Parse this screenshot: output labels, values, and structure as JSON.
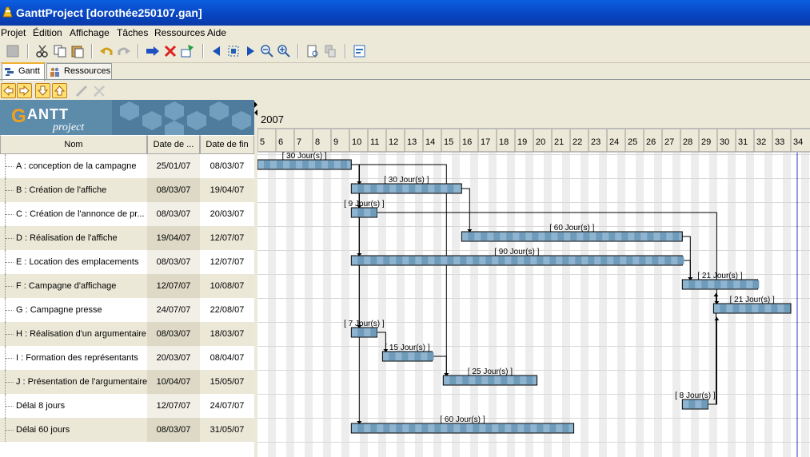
{
  "window": {
    "title": "GanttProject [dorothée250107.gan]"
  },
  "menu": [
    "Projet",
    "Édition",
    "Affichage",
    "Tâches",
    "Ressources",
    "Aide"
  ],
  "toolbar": {
    "icons": [
      "stop-icon",
      "cut-icon",
      "copy-icon",
      "paste-icon",
      "undo-icon",
      "redo-icon",
      "indent-icon",
      "delete-icon",
      "new-task-icon",
      "scroll-left-icon",
      "fit-icon",
      "scroll-right-icon",
      "zoom-out-icon",
      "zoom-in-icon",
      "preview-icon",
      "print-icon",
      "export-icon"
    ]
  },
  "tabs": [
    {
      "label": "Gantt"
    },
    {
      "label": "Ressources"
    }
  ],
  "table": {
    "columns": [
      "Nom",
      "Date de ...",
      "Date de fin"
    ],
    "rows": [
      {
        "name": "A : conception de la campagne",
        "start": "25/01/07",
        "end": "08/03/07"
      },
      {
        "name": "B : Création de l'affiche",
        "start": "08/03/07",
        "end": "19/04/07"
      },
      {
        "name": "C : Création de l'annonce de pr...",
        "start": "08/03/07",
        "end": "20/03/07"
      },
      {
        "name": "D : Réalisation de l'affiche",
        "start": "19/04/07",
        "end": "12/07/07"
      },
      {
        "name": "E : Location des emplacements",
        "start": "08/03/07",
        "end": "12/07/07"
      },
      {
        "name": "F : Campagne d'affichage",
        "start": "12/07/07",
        "end": "10/08/07"
      },
      {
        "name": "G : Campagne presse",
        "start": "24/07/07",
        "end": "22/08/07"
      },
      {
        "name": "H : Réalisation d'un argumentaire",
        "start": "08/03/07",
        "end": "18/03/07"
      },
      {
        "name": "I : Formation des représentants",
        "start": "20/03/07",
        "end": "08/04/07"
      },
      {
        "name": "J : Présentation de l'argumentaire",
        "start": "10/04/07",
        "end": "15/05/07"
      },
      {
        "name": "Délai 8 jours",
        "start": "12/07/07",
        "end": "24/07/07"
      },
      {
        "name": "Délai 60 jours",
        "start": "08/03/07",
        "end": "31/05/07"
      }
    ]
  },
  "gantt": {
    "year": "2007",
    "weeks": [
      "5",
      "6",
      "7",
      "8",
      "9",
      "10",
      "11",
      "12",
      "13",
      "14",
      "15",
      "16",
      "17",
      "18",
      "19",
      "20",
      "21",
      "22",
      "23",
      "24",
      "25",
      "26",
      "27",
      "28",
      "29",
      "30",
      "31",
      "32",
      "33",
      "34"
    ],
    "first_week": 5,
    "tasks": [
      {
        "start": 5.0,
        "end": 10.1,
        "label": "[ 30 Jour(s) ]"
      },
      {
        "start": 10.1,
        "end": 16.1,
        "label": "[ 30 Jour(s) ]"
      },
      {
        "start": 10.1,
        "end": 11.5,
        "label": "[ 9 Jour(s) ]"
      },
      {
        "start": 16.1,
        "end": 28.1,
        "label": "[ 60 Jour(s) ]"
      },
      {
        "start": 10.1,
        "end": 28.1,
        "label": "[ 90 Jour(s) ]"
      },
      {
        "start": 28.1,
        "end": 32.2,
        "label": "[ 21 Jour(s) ]"
      },
      {
        "start": 29.8,
        "end": 34.0,
        "label": "[ 21 Jour(s) ]"
      },
      {
        "start": 10.1,
        "end": 11.5,
        "label": "[ 7 Jour(s) ]"
      },
      {
        "start": 11.8,
        "end": 14.5,
        "label": "[ 15 Jour(s) ]"
      },
      {
        "start": 15.1,
        "end": 20.2,
        "label": "[ 25 Jour(s) ]"
      },
      {
        "start": 28.1,
        "end": 29.5,
        "label": "[ 8 Jour(s) ]"
      },
      {
        "start": 10.1,
        "end": 22.2,
        "label": "[ 60 Jour(s) ]"
      }
    ],
    "links": [
      [
        0,
        1
      ],
      [
        0,
        2
      ],
      [
        0,
        4
      ],
      [
        0,
        7
      ],
      [
        0,
        11
      ],
      [
        0,
        9
      ],
      [
        1,
        3
      ],
      [
        2,
        6
      ],
      [
        3,
        5
      ],
      [
        4,
        5
      ],
      [
        7,
        8
      ],
      [
        8,
        9
      ],
      [
        10,
        6
      ],
      [
        10,
        5
      ]
    ],
    "colors": {
      "bar": "#8eb4cf",
      "bar_dark": "#6f9bbb",
      "grid_shade": "#ededed",
      "today": "#3030c0"
    }
  }
}
